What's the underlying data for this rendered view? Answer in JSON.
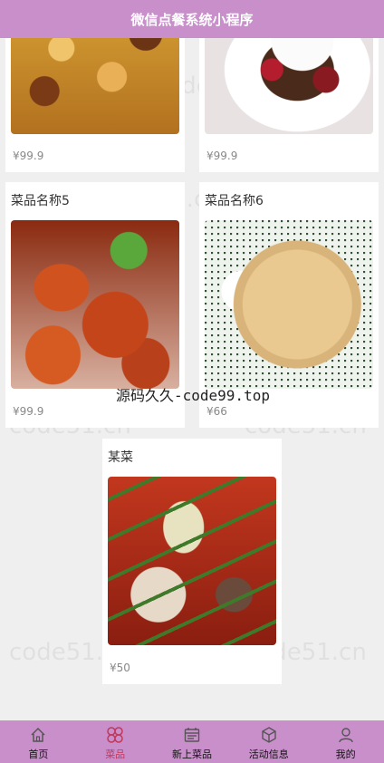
{
  "header": {
    "title": "微信点餐系统小程序"
  },
  "items": [
    {
      "name": "",
      "price": "¥99.9",
      "image": "chestnut-dish"
    },
    {
      "name": "",
      "price": "¥99.9",
      "image": "ice-cream-dessert"
    },
    {
      "name": "菜品名称5",
      "price": "¥99.9",
      "image": "crayfish"
    },
    {
      "name": "菜品名称6",
      "price": "¥66",
      "image": "dessert-plate"
    },
    {
      "name": "某菜",
      "price": "¥50",
      "image": "skewers"
    }
  ],
  "watermark": "源码久久-code99.top",
  "faint_watermark": "code51.cn",
  "tabbar": [
    {
      "label": "首页",
      "icon": "home-icon"
    },
    {
      "label": "菜品",
      "icon": "clover-icon",
      "active": true
    },
    {
      "label": "新上菜品",
      "icon": "calendar-icon"
    },
    {
      "label": "活动信息",
      "icon": "box-icon"
    },
    {
      "label": "我的",
      "icon": "user-icon"
    }
  ],
  "colors": {
    "accent": "#c98fcb",
    "active_tab": "#c0385a"
  }
}
